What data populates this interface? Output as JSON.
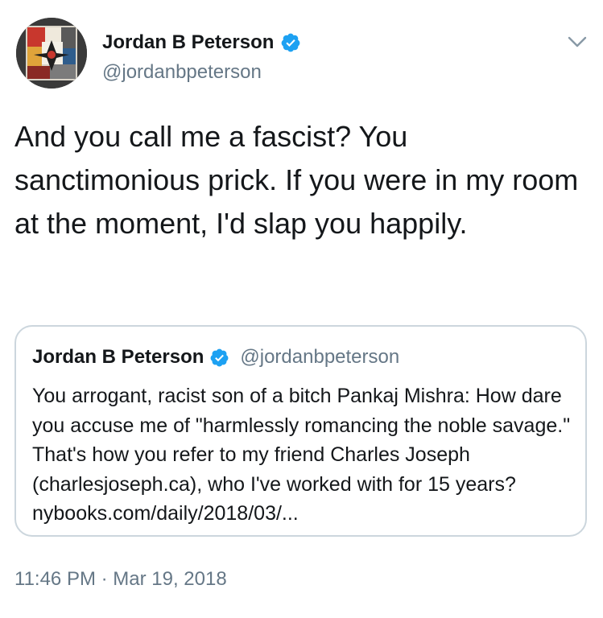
{
  "author": {
    "display_name": "Jordan B Peterson",
    "handle": "@jordanbpeterson",
    "avatar_icon": "avatar-image",
    "verified_icon": "verified-badge-icon",
    "verified_color": "#1da1f2"
  },
  "menu": {
    "icon": "chevron-down-icon"
  },
  "tweet": {
    "text": "And you call me a fascist? You sanctimonious prick. If you were in my room at the moment, I'd slap you happily."
  },
  "quoted_tweet": {
    "display_name": "Jordan B Peterson",
    "handle": "@jordanbpeterson",
    "text": "You arrogant, racist son of a bitch Pankaj Mishra: How dare you accuse me of \"harmlessly romancing the noble savage.\" That's how you refer to my friend Charles Joseph (charlesjoseph.ca), who I've worked with for 15 years? nybooks.com/daily/2018/03/..."
  },
  "meta": {
    "timestamp": "11:46 PM · Mar 19, 2018"
  },
  "colors": {
    "text_primary": "#14171a",
    "text_secondary": "#657786",
    "border": "#ccd6dd",
    "accent": "#1da1f2"
  }
}
